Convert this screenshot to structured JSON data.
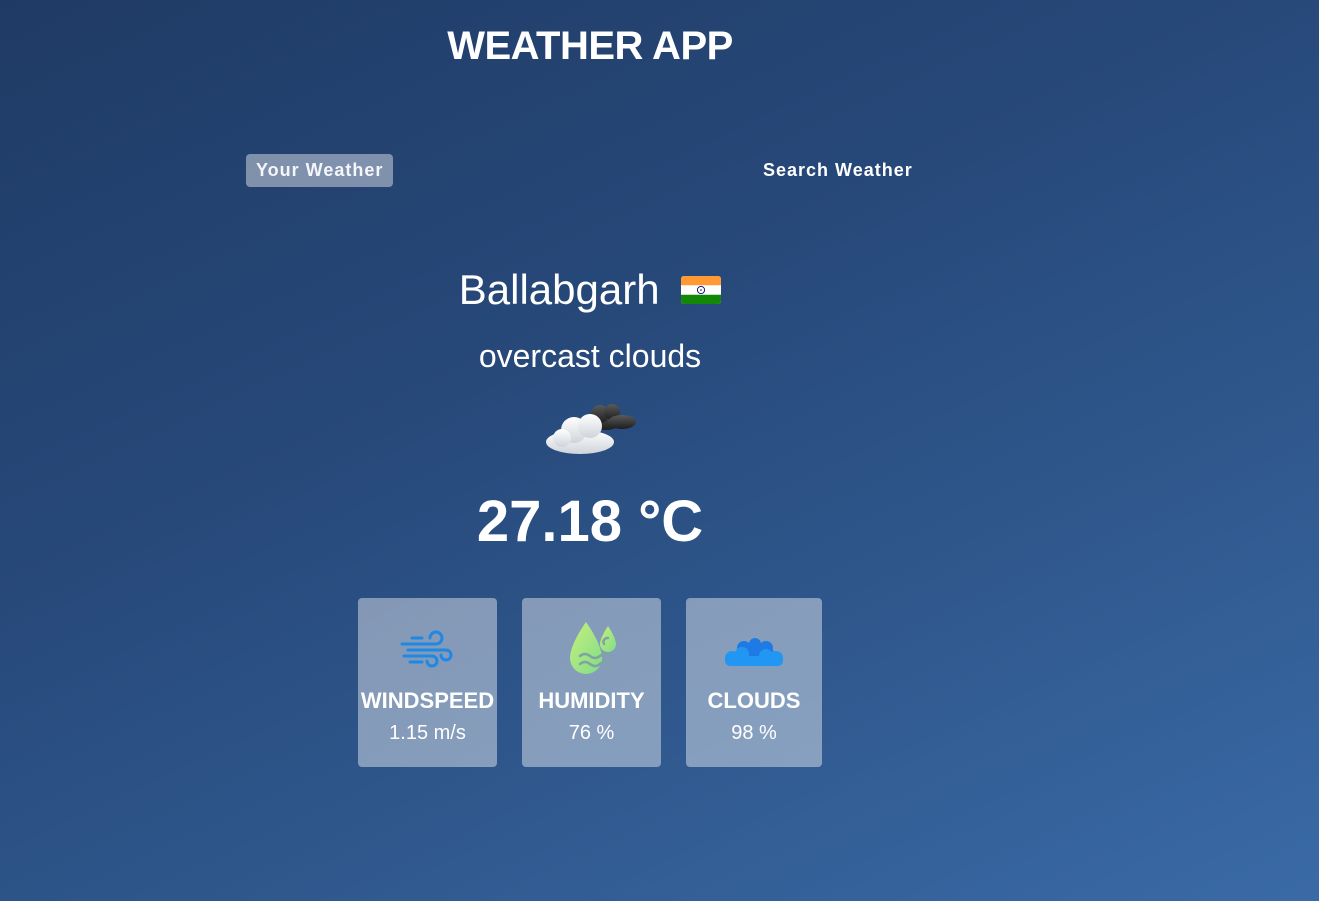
{
  "app": {
    "title": "WEATHER APP"
  },
  "tabs": {
    "your_weather": "Your Weather",
    "search_weather": "Search Weather"
  },
  "location": {
    "city": "Ballabgarh",
    "country_flag_icon": "india-flag-icon"
  },
  "current": {
    "description": "overcast clouds",
    "icon": "overcast-clouds-icon",
    "temperature": "27.18 °C"
  },
  "stats": {
    "windspeed": {
      "label": "WINDSPEED",
      "value": "1.15 m/s",
      "icon": "wind-icon"
    },
    "humidity": {
      "label": "HUMIDITY",
      "value": "76 %",
      "icon": "humidity-icon"
    },
    "clouds": {
      "label": "CLOUDS",
      "value": "98 %",
      "icon": "clouds-icon"
    }
  },
  "colors": {
    "background_top": "#1f3b65",
    "background_bottom": "#3a6aa6",
    "card_bg": "rgba(255,255,255,0.42)",
    "wind_icon": "#1e88e5",
    "humidity_icon": "#a6e87a",
    "clouds_icon": "#2196f3"
  }
}
